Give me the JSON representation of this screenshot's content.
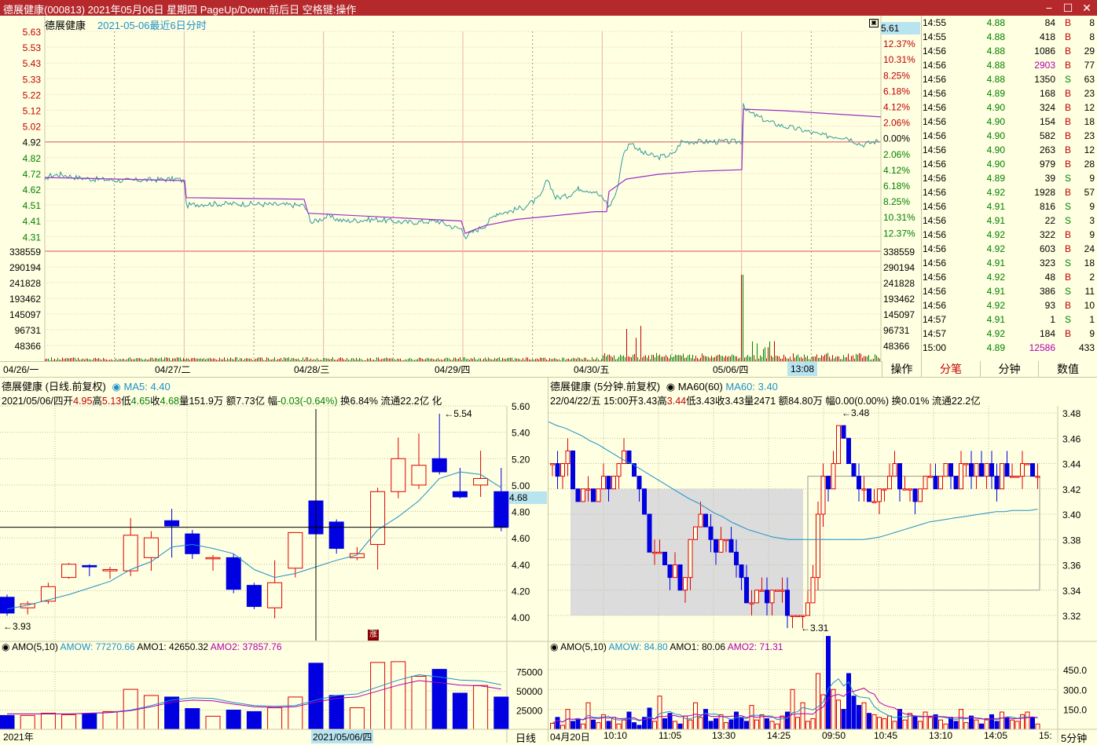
{
  "window": {
    "title": "德展健康(000813) 2021年05月06日 星期四 PageUp/Down:前后日 空格键:操作",
    "min_label": "−",
    "max_label": "☐",
    "close_label": "✕"
  },
  "intraday": {
    "name": "德展健康",
    "subtitle": "2021-05-06最近6日分时",
    "corner_box": "5.61",
    "price_ticks": [
      "5.63",
      "5.53",
      "5.43",
      "5.33",
      "5.22",
      "5.12",
      "5.02",
      "4.92",
      "4.82",
      "4.72",
      "4.62",
      "4.51",
      "4.41",
      "4.31"
    ],
    "pct_ticks": [
      "12.37%",
      "10.31%",
      "8.25%",
      "6.18%",
      "4.12%",
      "2.06%",
      "0.00%",
      "2.06%",
      "4.12%",
      "6.18%",
      "8.25%",
      "10.31%",
      "12.37%"
    ],
    "vol_ticks": [
      "338559",
      "290194",
      "241828",
      "193462",
      "145097",
      "96731",
      "48366"
    ],
    "date_labels": [
      "04/26/一",
      "04/27/二",
      "04/28/三",
      "04/29/四",
      "04/30/五",
      "05/06/四"
    ],
    "cursor_time": "13:08",
    "prev_close": 4.92
  },
  "trades": [
    {
      "t": "14:55",
      "p": "4.88",
      "v": "84",
      "s": "B",
      "n": "8"
    },
    {
      "t": "14:55",
      "p": "4.88",
      "v": "418",
      "s": "B",
      "n": "8"
    },
    {
      "t": "14:56",
      "p": "4.88",
      "v": "1086",
      "s": "B",
      "n": "29"
    },
    {
      "t": "14:56",
      "p": "4.88",
      "v": "2903",
      "s": "B",
      "n": "77"
    },
    {
      "t": "14:56",
      "p": "4.88",
      "v": "1350",
      "s": "S",
      "n": "63"
    },
    {
      "t": "14:56",
      "p": "4.89",
      "v": "168",
      "s": "B",
      "n": "23"
    },
    {
      "t": "14:56",
      "p": "4.90",
      "v": "324",
      "s": "B",
      "n": "12"
    },
    {
      "t": "14:56",
      "p": "4.90",
      "v": "154",
      "s": "B",
      "n": "18"
    },
    {
      "t": "14:56",
      "p": "4.90",
      "v": "582",
      "s": "B",
      "n": "23"
    },
    {
      "t": "14:56",
      "p": "4.90",
      "v": "263",
      "s": "B",
      "n": "12"
    },
    {
      "t": "14:56",
      "p": "4.90",
      "v": "979",
      "s": "B",
      "n": "28"
    },
    {
      "t": "14:56",
      "p": "4.89",
      "v": "39",
      "s": "S",
      "n": "9"
    },
    {
      "t": "14:56",
      "p": "4.92",
      "v": "1928",
      "s": "B",
      "n": "57"
    },
    {
      "t": "14:56",
      "p": "4.91",
      "v": "816",
      "s": "S",
      "n": "9"
    },
    {
      "t": "14:56",
      "p": "4.91",
      "v": "22",
      "s": "S",
      "n": "3"
    },
    {
      "t": "14:56",
      "p": "4.92",
      "v": "322",
      "s": "B",
      "n": "9"
    },
    {
      "t": "14:56",
      "p": "4.92",
      "v": "603",
      "s": "B",
      "n": "24"
    },
    {
      "t": "14:56",
      "p": "4.91",
      "v": "323",
      "s": "S",
      "n": "18"
    },
    {
      "t": "14:56",
      "p": "4.92",
      "v": "48",
      "s": "B",
      "n": "2"
    },
    {
      "t": "14:56",
      "p": "4.91",
      "v": "386",
      "s": "S",
      "n": "11"
    },
    {
      "t": "14:56",
      "p": "4.92",
      "v": "93",
      "s": "B",
      "n": "10"
    },
    {
      "t": "14:57",
      "p": "4.91",
      "v": "1",
      "s": "S",
      "n": "1"
    },
    {
      "t": "14:57",
      "p": "4.92",
      "v": "184",
      "s": "B",
      "n": "9"
    },
    {
      "t": "15:00",
      "p": "4.89",
      "v": "12586",
      "s": "",
      "n": "433"
    }
  ],
  "tabs": {
    "ops": "操作",
    "ticks": "分笔",
    "minute": "分钟",
    "data": "数值"
  },
  "daily": {
    "head": "德展健康 (日线.前复权)",
    "ma_label": "MA5: 4.40",
    "info": {
      "date": "2021/05/06/四",
      "open_l": "开",
      "open": "4.95",
      "high_l": "高",
      "high": "5.13",
      "low_l": "低",
      "low": "4.65",
      "close_l": "收",
      "close": "4.68",
      "vol": "量151.9万",
      "amt": "额7.73亿",
      "chg_l": "幅",
      "chg": "-0.03(-0.64%)",
      "tail": "换6.84% 流通22.2亿 化"
    },
    "y_ticks": [
      "5.60",
      "5.40",
      "5.20",
      "5.00",
      "4.80",
      "4.60",
      "4.40",
      "4.20",
      "4.00"
    ],
    "price_box": "4.68",
    "max_label": "5.54",
    "min_label": "3.93",
    "zhang": "涨",
    "amo_head": "AMO(5,10)",
    "amo_labels": {
      "amow": "AMOW: 77270.66",
      "amo1": "AMO1: 42650.32",
      "amo2": "AMO2: 37857.76"
    },
    "amo_ticks": [
      "75000",
      "50000",
      "25000"
    ],
    "x_left": "2021年",
    "x_cursor": "2021/05/06/四",
    "period": "日线",
    "candles": [
      [
        4.15,
        4.03,
        4.17,
        4.01
      ],
      [
        4.07,
        4.1,
        4.12,
        4.02
      ],
      [
        4.12,
        4.23,
        4.26,
        4.1
      ],
      [
        4.3,
        4.4,
        4.41,
        4.29
      ],
      [
        4.39,
        4.38,
        4.4,
        4.31
      ],
      [
        4.35,
        4.36,
        4.38,
        4.29
      ],
      [
        4.35,
        4.62,
        4.75,
        4.31
      ],
      [
        4.45,
        4.6,
        4.65,
        4.35
      ],
      [
        4.73,
        4.69,
        4.82,
        4.45
      ],
      [
        4.63,
        4.48,
        4.66,
        4.44
      ],
      [
        4.45,
        4.45,
        4.47,
        4.35
      ],
      [
        4.45,
        4.21,
        4.48,
        4.18
      ],
      [
        4.24,
        4.08,
        4.26,
        4.06
      ],
      [
        4.07,
        4.26,
        4.43,
        3.99
      ],
      [
        4.37,
        4.64,
        4.64,
        4.3
      ],
      [
        4.88,
        4.63,
        4.99,
        4.48
      ],
      [
        4.72,
        4.52,
        4.74,
        4.48
      ],
      [
        4.45,
        4.48,
        4.53,
        4.43
      ],
      [
        4.55,
        4.95,
        4.98,
        4.36
      ],
      [
        4.95,
        5.2,
        5.36,
        4.9
      ],
      [
        5.0,
        5.15,
        5.39,
        4.97
      ],
      [
        5.2,
        5.1,
        5.54,
        5.08
      ],
      [
        4.95,
        4.91,
        5.13,
        4.9
      ],
      [
        5.0,
        5.05,
        5.26,
        4.91
      ],
      [
        4.95,
        4.68,
        5.13,
        4.65
      ]
    ],
    "ma5": [
      4.06,
      4.09,
      4.13,
      4.17,
      4.22,
      4.27,
      4.36,
      4.42,
      4.53,
      4.55,
      4.52,
      4.48,
      4.36,
      4.3,
      4.33,
      4.38,
      4.43,
      4.47,
      4.66,
      4.76,
      4.88,
      5.05,
      5.1,
      5.08,
      4.98
    ],
    "amo": [
      18,
      18,
      21,
      19,
      20,
      23,
      52,
      44,
      42,
      27,
      17,
      25,
      23,
      28,
      42,
      86,
      44,
      28,
      87,
      88,
      69,
      78,
      47,
      57,
      42
    ],
    "amo_ma": [
      20,
      20,
      20,
      20,
      21,
      22,
      25,
      31,
      38,
      41,
      40,
      35,
      31,
      30,
      31,
      38,
      44,
      46,
      55,
      64,
      71,
      68,
      64,
      63,
      58
    ]
  },
  "intraday5": {
    "head": "德展健康 (5分钟.前复权)",
    "ma60_head": "MA60(60)",
    "ma60_label": "MA60: 3.40",
    "info": {
      "date": "22/04/22/五",
      "time": "15:00",
      "open_l": "开",
      "open": "3.43",
      "high_l": "高",
      "high": "3.44",
      "low_l": "低",
      "low": "3.43",
      "close_l": "收",
      "close": "3.43",
      "vol": "量2471",
      "amt": "额84.80万",
      "chg": "幅0.00(0.00%)",
      "tail": "换0.01% 流通22.2亿"
    },
    "y_ticks": [
      "3.48",
      "3.46",
      "3.44",
      "3.42",
      "3.40",
      "3.38",
      "3.36",
      "3.34",
      "3.32"
    ],
    "max_label": "3.48",
    "min_label": "3.31",
    "amo_head": "AMO(5,10)",
    "amo_labels": {
      "amow": "AMOW: 84.80",
      "amo1": "AMO1: 80.06",
      "amo2": "AMO2: 71.31"
    },
    "amo_ticks": [
      "450.0",
      "300.0",
      "150.0"
    ],
    "x_labels": [
      "04月20日",
      "10:10",
      "11:05",
      "13:30",
      "14:25",
      "09:50",
      "10:45",
      "13:10",
      "14:05",
      "15:"
    ],
    "period": "5分钟",
    "closes": [
      3.44,
      3.43,
      3.44,
      3.45,
      3.42,
      3.41,
      3.42,
      3.42,
      3.41,
      3.42,
      3.43,
      3.42,
      3.43,
      3.44,
      3.45,
      3.44,
      3.43,
      3.42,
      3.4,
      3.37,
      3.37,
      3.37,
      3.36,
      3.35,
      3.36,
      3.34,
      3.35,
      3.38,
      3.39,
      3.4,
      3.39,
      3.38,
      3.37,
      3.38,
      3.38,
      3.37,
      3.36,
      3.35,
      3.33,
      3.33,
      3.34,
      3.34,
      3.33,
      3.34,
      3.34,
      3.34,
      3.32,
      3.32,
      3.32,
      3.32,
      3.33,
      3.35,
      3.4,
      3.43,
      3.42,
      3.44,
      3.47,
      3.46,
      3.44,
      3.43,
      3.42,
      3.42,
      3.41,
      3.41,
      3.42,
      3.42,
      3.43,
      3.44,
      3.42,
      3.42,
      3.42,
      3.41,
      3.42,
      3.43,
      3.43,
      3.42,
      3.43,
      3.44,
      3.43,
      3.42,
      3.44,
      3.44,
      3.43,
      3.44,
      3.43,
      3.44,
      3.43,
      3.42,
      3.44,
      3.43,
      3.43,
      3.43,
      3.44,
      3.44,
      3.43,
      3.43
    ],
    "ma60": [
      3.473,
      3.47,
      3.468,
      3.465,
      3.462,
      3.458,
      3.455,
      3.451,
      3.447,
      3.443,
      3.44,
      3.436,
      3.432,
      3.428,
      3.424,
      3.42,
      3.416,
      3.412,
      3.409,
      3.405,
      3.401,
      3.398,
      3.394,
      3.391,
      3.388,
      3.386,
      3.384,
      3.382,
      3.381,
      3.38,
      3.38,
      3.38,
      3.38,
      3.38,
      3.38,
      3.38,
      3.38,
      3.38,
      3.38,
      3.381,
      3.382,
      3.384,
      3.386,
      3.388,
      3.39,
      3.392,
      3.394,
      3.395,
      3.396,
      3.397,
      3.398,
      3.399,
      3.4,
      3.401,
      3.402,
      3.402,
      3.403,
      3.403,
      3.403,
      3.404
    ],
    "amo": [
      45,
      90,
      30,
      150,
      60,
      80,
      40,
      200,
      70,
      50,
      110,
      60,
      90,
      40,
      70,
      130,
      50,
      30,
      90,
      160,
      60,
      250,
      80,
      120,
      60,
      40,
      100,
      70,
      200,
      90,
      150,
      60,
      80,
      110,
      50,
      70,
      130,
      90,
      60,
      180,
      70,
      110,
      80,
      60,
      40,
      100,
      130,
      300,
      90,
      200,
      60,
      80,
      420,
      260,
      700,
      300,
      220,
      150,
      420,
      250,
      180,
      200,
      120,
      110,
      90,
      80,
      100,
      60,
      150,
      70,
      120,
      100,
      60,
      130,
      90,
      110,
      70,
      40,
      90,
      60,
      150,
      50,
      100,
      70,
      40,
      80,
      110,
      60,
      130,
      90,
      70,
      60,
      110,
      130,
      90,
      40
    ]
  }
}
